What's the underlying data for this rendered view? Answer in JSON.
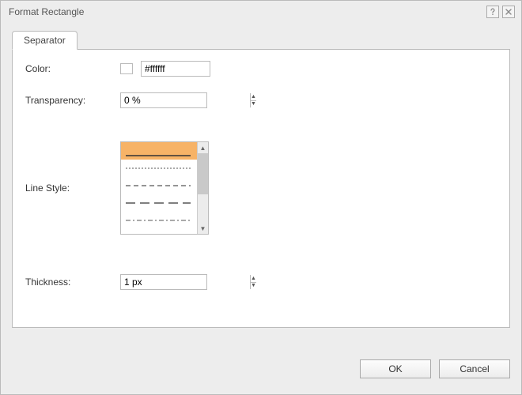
{
  "window": {
    "title": "Format Rectangle"
  },
  "tabs": {
    "separator": "Separator"
  },
  "labels": {
    "color": "Color:",
    "transparency": "Transparency:",
    "lineStyle": "Line Style:",
    "thickness": "Thickness:"
  },
  "values": {
    "color_hex": "#ffffff",
    "transparency": "0 %",
    "thickness": "1 px"
  },
  "buttons": {
    "ok": "OK",
    "cancel": "Cancel"
  }
}
